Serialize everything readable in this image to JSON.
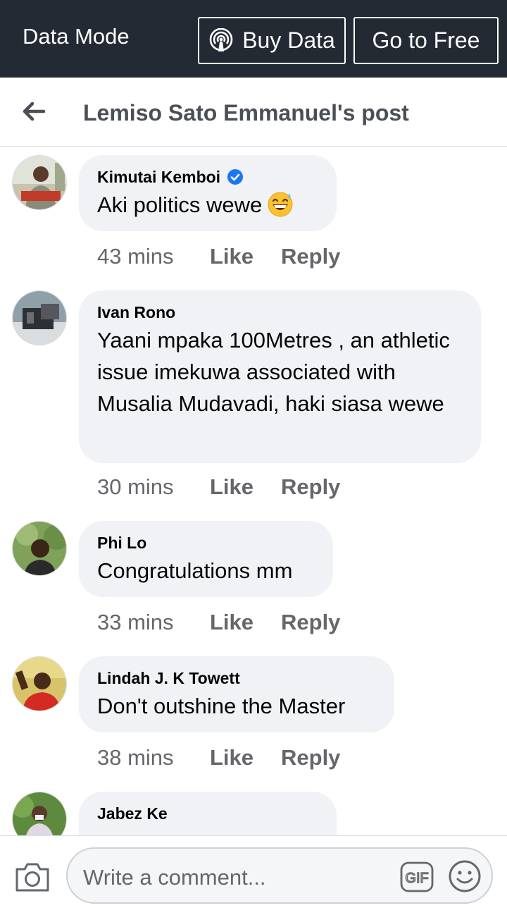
{
  "topbar": {
    "mode_label": "Data Mode",
    "buy_label": "Buy Data",
    "free_label": "Go to Free",
    "buy_icon": "broadcast-signal-icon"
  },
  "header": {
    "title": "Lemiso Sato Emmanuel's post",
    "back_icon": "arrow-left-icon"
  },
  "comments": [
    {
      "name": "Kimutai Kemboi",
      "verified": true,
      "text": "Aki politics wewe",
      "emoji": "grinning-sweat-emoji",
      "time": "43 mins",
      "like": "Like",
      "reply": "Reply"
    },
    {
      "name": "Ivan Rono",
      "verified": false,
      "text": "Yaani mpaka 100Metres , an athletic issue imekuwa associated with Musalia Mudavadi, haki siasa wewe",
      "time": "30 mins",
      "like": "Like",
      "reply": "Reply"
    },
    {
      "name": "Phi Lo",
      "verified": false,
      "text": "Congratulations mm",
      "time": "33 mins",
      "like": "Like",
      "reply": "Reply"
    },
    {
      "name": "Lindah J. K Towett",
      "verified": false,
      "text": "Don't outshine the Master",
      "time": "38 mins",
      "like": "Like",
      "reply": "Reply"
    },
    {
      "name": "Jabez Ke",
      "verified": false,
      "text": "",
      "time": "",
      "like": "",
      "reply": ""
    }
  ],
  "composer": {
    "placeholder": "Write a comment...",
    "camera_icon": "camera-icon",
    "gif_icon": "gif-icon",
    "emoji_icon": "smiley-icon"
  },
  "colors": {
    "topbar_bg": "#242a33",
    "bubble_bg": "#f0f2f5",
    "meta_text": "#65676b",
    "verified_blue": "#1877f2"
  }
}
